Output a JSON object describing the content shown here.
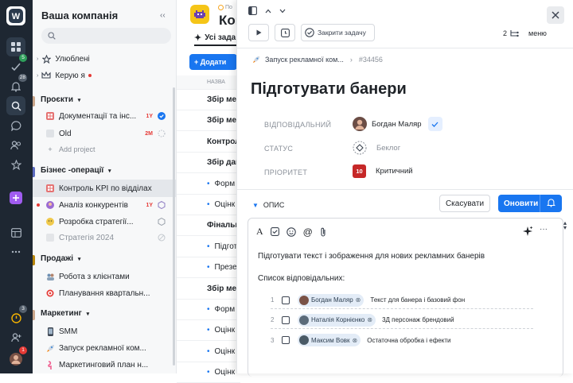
{
  "sidebar": {
    "workspace": "Ваша компанія",
    "favorites": "Улюблені",
    "managed_by_me": "Керую я",
    "sections": {
      "projects": "Проєкти",
      "biz_ops": "Бізнес -операції",
      "sales": "Продажі",
      "marketing": "Маркетинг"
    },
    "projects": [
      {
        "label": "Документації та інс...",
        "tag": "1Y"
      },
      {
        "label": "Old",
        "tag": "2M"
      },
      {
        "label": "Add project",
        "tag": ""
      }
    ],
    "biz_ops": [
      {
        "label": "Контроль KPI по відділах",
        "tag": ""
      },
      {
        "label": "Аналіз конкурентів",
        "tag": "1Y"
      },
      {
        "label": "Розробка стратегії...",
        "tag": ""
      },
      {
        "label": "Стратегія 2024",
        "tag": ""
      }
    ],
    "sales": [
      {
        "label": "Робота з клієнтами"
      },
      {
        "label": "Планування квартальн..."
      }
    ],
    "marketing": [
      {
        "label": "SMM"
      },
      {
        "label": "Запуск рекламної ком..."
      },
      {
        "label": "Маркетинговий план н..."
      }
    ]
  },
  "rail": {
    "badges": {
      "tasks": "5",
      "notifications": "28",
      "timer": "3",
      "profile": "1"
    }
  },
  "list": {
    "project_title_prefix": "По",
    "project_title": "Кон",
    "all_tasks_tab": "Усі зада",
    "add_button": "+ Додати",
    "column_name": "НАЗВА",
    "rows": [
      {
        "text": "Збір мет",
        "type": "group"
      },
      {
        "text": "Збір мет",
        "type": "group"
      },
      {
        "text": "Контрол",
        "type": "group"
      },
      {
        "text": "Збір дан",
        "type": "group"
      },
      {
        "text": "Форм",
        "type": "task"
      },
      {
        "text": "Оцінк",
        "type": "task"
      },
      {
        "text": "Фінальн",
        "type": "group"
      },
      {
        "text": "Підгот",
        "type": "task"
      },
      {
        "text": "Презе",
        "type": "task"
      },
      {
        "text": "Збір мет",
        "type": "group"
      },
      {
        "text": "Форм",
        "type": "task"
      },
      {
        "text": "Оцінк",
        "type": "task"
      },
      {
        "text": "Оцінк",
        "type": "task"
      },
      {
        "text": "Оцінк",
        "type": "task"
      }
    ]
  },
  "task": {
    "close_task_button": "Закрити задачу",
    "subtask_count": "2",
    "menu_label": "меню",
    "breadcrumb_project": "Запуск рекламної ком...",
    "breadcrumb_id": "#34456",
    "title": "Підготувати банери",
    "fields": {
      "assignee_label": "ВІДПОВІДАЛЬНИЙ",
      "assignee_value": "Богдан Маляр",
      "status_label": "СТАТУС",
      "status_value": "Беклог",
      "priority_label": "ПРІОРИТЕТ",
      "priority_number": "10",
      "priority_value": "Критичний"
    },
    "description_label": "ОПИС",
    "cancel_button": "Скасувати",
    "update_button": "Оновити",
    "description_text": "Підготувати текст і зображення для нових рекламних банерів",
    "list_heading": "Список відповідальних:",
    "checklist": [
      {
        "num": "1",
        "person": "Богдан Маляр",
        "text": "Текст для банера і базовий фон"
      },
      {
        "num": "2",
        "person": "Наталія Корнієнко",
        "text": "3Д персонаж брендовий"
      },
      {
        "num": "3",
        "person": "Максим Вовк",
        "text": "Остаточна обробка і ефекти"
      }
    ]
  },
  "colors": {
    "rail": "#1e2732",
    "accent": "#1976f0",
    "critical": "#c62828",
    "overdue_tag": "#e53935"
  }
}
